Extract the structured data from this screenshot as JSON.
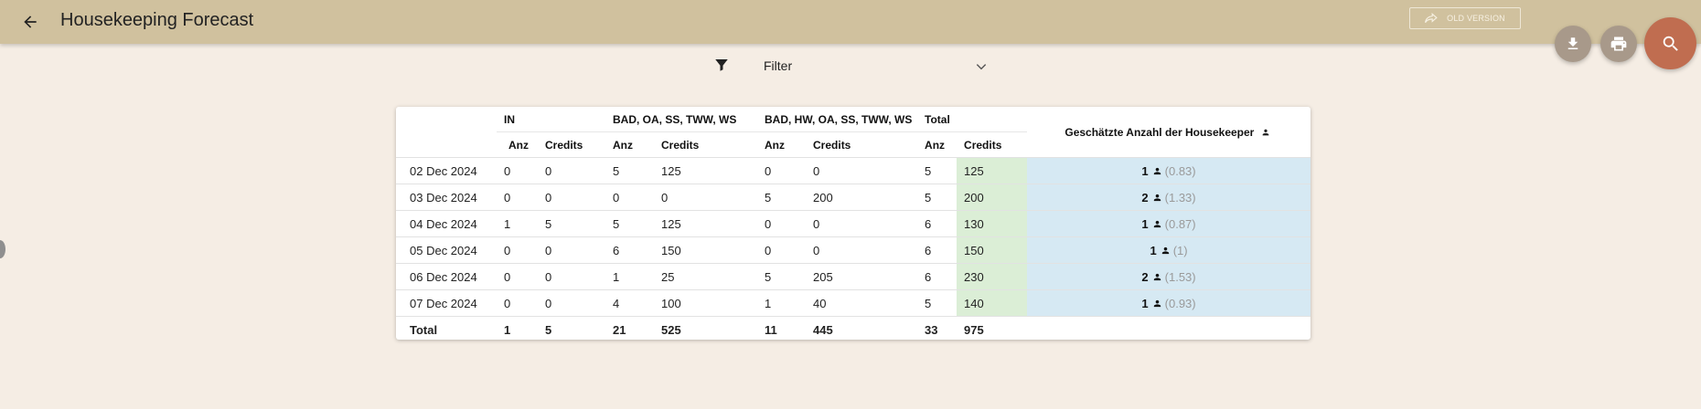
{
  "header": {
    "title": "Housekeeping Forecast",
    "old_version_label": "OLD VERSION"
  },
  "icons": {
    "back": "arrow-left-icon",
    "old_version": "redo-arrow-icon",
    "download": "download-icon",
    "print": "printer-icon",
    "search": "search-icon",
    "filter": "funnel-icon",
    "chevron": "chevron-down-icon",
    "person": "person-icon"
  },
  "colors": {
    "topbar": "#d0c19e",
    "background": "#f5ede4",
    "search_fab": "#c06d50",
    "fab": "#a8998a",
    "credits_total_column": "#dbeed6",
    "housekeeper_column": "#d6e9f3"
  },
  "filter": {
    "label": "Filter"
  },
  "table": {
    "groups": {
      "in": "IN",
      "bad_oa": "BAD, OA, SS, TWW, WS",
      "bad_hw": "BAD, HW, OA, SS, TWW, WS",
      "total": "Total",
      "housekeeper": "Geschätzte Anzahl der Housekeeper"
    },
    "subheaders": {
      "anz": "Anz",
      "credits": "Credits"
    },
    "rows": [
      {
        "date": "02 Dec 2024",
        "in_anz": "0",
        "in_credits": "0",
        "g1_anz": "5",
        "g1_credits": "125",
        "g2_anz": "0",
        "g2_credits": "0",
        "total_anz": "5",
        "total_credits": "125",
        "hk": "1",
        "hk_est": "(0.83)"
      },
      {
        "date": "03 Dec 2024",
        "in_anz": "0",
        "in_credits": "0",
        "g1_anz": "0",
        "g1_credits": "0",
        "g2_anz": "5",
        "g2_credits": "200",
        "total_anz": "5",
        "total_credits": "200",
        "hk": "2",
        "hk_est": "(1.33)"
      },
      {
        "date": "04 Dec 2024",
        "in_anz": "1",
        "in_credits": "5",
        "g1_anz": "5",
        "g1_credits": "125",
        "g2_anz": "0",
        "g2_credits": "0",
        "total_anz": "6",
        "total_credits": "130",
        "hk": "1",
        "hk_est": "(0.87)"
      },
      {
        "date": "05 Dec 2024",
        "in_anz": "0",
        "in_credits": "0",
        "g1_anz": "6",
        "g1_credits": "150",
        "g2_anz": "0",
        "g2_credits": "0",
        "total_anz": "6",
        "total_credits": "150",
        "hk": "1",
        "hk_est": "(1)"
      },
      {
        "date": "06 Dec 2024",
        "in_anz": "0",
        "in_credits": "0",
        "g1_anz": "1",
        "g1_credits": "25",
        "g2_anz": "5",
        "g2_credits": "205",
        "total_anz": "6",
        "total_credits": "230",
        "hk": "2",
        "hk_est": "(1.53)"
      },
      {
        "date": "07 Dec 2024",
        "in_anz": "0",
        "in_credits": "0",
        "g1_anz": "4",
        "g1_credits": "100",
        "g2_anz": "1",
        "g2_credits": "40",
        "total_anz": "5",
        "total_credits": "140",
        "hk": "1",
        "hk_est": "(0.93)"
      }
    ],
    "totals": {
      "label": "Total",
      "in_anz": "1",
      "in_credits": "5",
      "g1_anz": "21",
      "g1_credits": "525",
      "g2_anz": "11",
      "g2_credits": "445",
      "total_anz": "33",
      "total_credits": "975"
    }
  }
}
